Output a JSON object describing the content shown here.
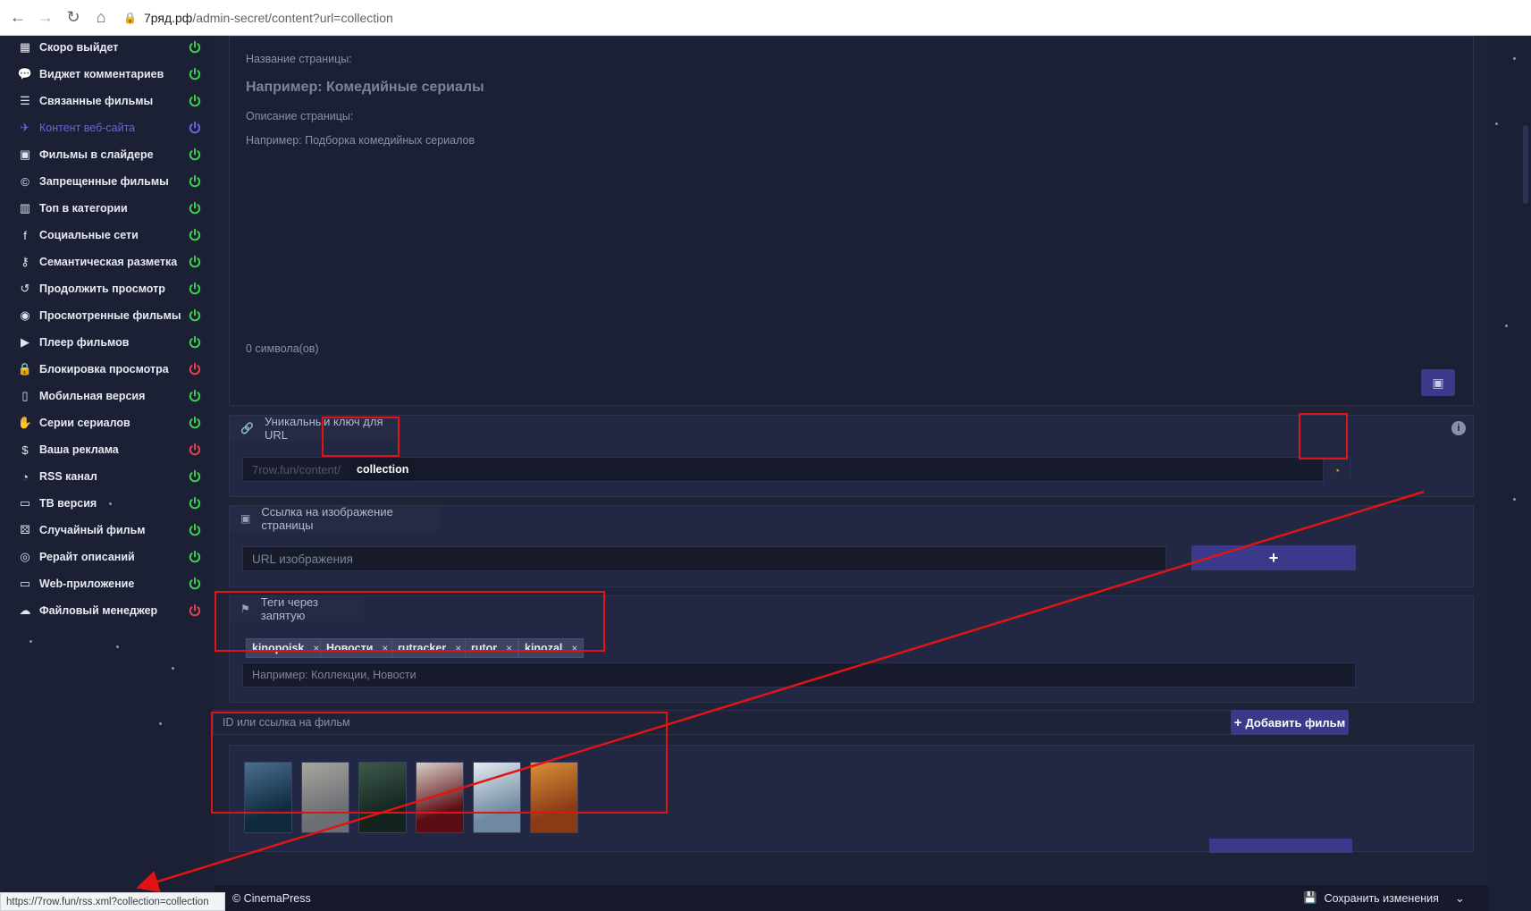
{
  "browser": {
    "url_host": "7ряд.рф",
    "url_path": "/admin-secret/content?url=collection"
  },
  "sidebar": {
    "items": [
      {
        "label": "Скоро выйдет",
        "icon": "calendar-icon",
        "glyph": "▦",
        "power": "green"
      },
      {
        "label": "Виджет комментариев",
        "icon": "comments-icon",
        "glyph": "💬",
        "power": "green"
      },
      {
        "label": "Связанные фильмы",
        "icon": "list-icon",
        "glyph": "☰",
        "power": "green"
      },
      {
        "label": "Контент веб-сайта",
        "icon": "rocket-icon",
        "glyph": "✈",
        "power": "violet",
        "active": true
      },
      {
        "label": "Фильмы в слайдере",
        "icon": "images-icon",
        "glyph": "▣",
        "power": "green"
      },
      {
        "label": "Запрещенные фильмы",
        "icon": "copyright-icon",
        "glyph": "©",
        "power": "green"
      },
      {
        "label": "Топ в категории",
        "icon": "chart-icon",
        "glyph": "▥",
        "power": "green"
      },
      {
        "label": "Социальные сети",
        "icon": "facebook-icon",
        "glyph": "f",
        "power": "green"
      },
      {
        "label": "Семантическая разметка",
        "icon": "key-icon",
        "glyph": "⚷",
        "power": "green"
      },
      {
        "label": "Продолжить просмотр",
        "icon": "history-icon",
        "glyph": "↺",
        "power": "green"
      },
      {
        "label": "Просмотренные фильмы",
        "icon": "eye-icon",
        "glyph": "◉",
        "power": "green"
      },
      {
        "label": "Плеер фильмов",
        "icon": "play-icon",
        "glyph": "▶",
        "power": "green"
      },
      {
        "label": "Блокировка просмотра",
        "icon": "lock-icon",
        "glyph": "🔒",
        "power": "red"
      },
      {
        "label": "Мобильная версия",
        "icon": "mobile-icon",
        "glyph": "▯",
        "power": "green"
      },
      {
        "label": "Серии сериалов",
        "icon": "hand-icon",
        "glyph": "✋",
        "power": "green"
      },
      {
        "label": "Ваша реклама",
        "icon": "dollar-icon",
        "glyph": "$",
        "power": "red"
      },
      {
        "label": "RSS канал",
        "icon": "rss-icon",
        "glyph": "◔",
        "power": "green"
      },
      {
        "label": "ТВ версия",
        "icon": "tv-icon",
        "glyph": "▭",
        "power": "green"
      },
      {
        "label": "Случайный фильм",
        "icon": "dice-icon",
        "glyph": "⚄",
        "power": "green"
      },
      {
        "label": "Рерайт описаний",
        "icon": "cookie-icon",
        "glyph": "◎",
        "power": "green"
      },
      {
        "label": "Web-приложение",
        "icon": "desktop-icon",
        "glyph": "▭",
        "power": "green"
      },
      {
        "label": "Файловый менеджер",
        "icon": "cloud-upload-icon",
        "glyph": "☁",
        "power": "red"
      }
    ]
  },
  "description": {
    "title_label": "Название страницы:",
    "title_placeholder": "Например: Комедийные сериалы",
    "desc_label": "Описание страницы:",
    "desc_placeholder": "Например: Подборка комедийных сериалов",
    "char_count": "0 символа(ов)"
  },
  "url_key": {
    "header": "Уникальный ключ для URL",
    "prefix": "7row.fun/content/",
    "value": "collection"
  },
  "image_link": {
    "header": "Ссылка на изображение страницы",
    "placeholder": "URL изображения",
    "add_label": "+"
  },
  "tags": {
    "header": "Теги через запятую",
    "items": [
      "kinopoisk",
      "Новости",
      "rutracker",
      "rutor",
      "kinozal"
    ],
    "remove_glyph": "×",
    "placeholder": "Например: Коллекции, Новости"
  },
  "films": {
    "input_placeholder": "ID или ссылка на фильм",
    "add_button": "Добавить фильм",
    "posters": [
      {
        "name": "poster-1",
        "colors": [
          "#0f2a3f",
          "#4b6f8f"
        ]
      },
      {
        "name": "poster-2",
        "colors": [
          "#6b6e75",
          "#a8a59c"
        ]
      },
      {
        "name": "poster-3",
        "colors": [
          "#13241f",
          "#3e5a4c"
        ]
      },
      {
        "name": "poster-4",
        "colors": [
          "#5a0d12",
          "#d9cfc7"
        ]
      },
      {
        "name": "poster-5",
        "colors": [
          "#6f8aa0",
          "#e4eaef"
        ]
      },
      {
        "name": "poster-6",
        "colors": [
          "#8a3a14",
          "#d9903a"
        ]
      }
    ]
  },
  "footer": {
    "copyright": "© CinemaPress",
    "save_label": "Сохранить изменения"
  },
  "status_bar": {
    "url": "https://7row.fun/rss.xml?collection=collection"
  },
  "colors": {
    "accent": "#3b3a8a",
    "power_green": "#3ecf4f",
    "power_red": "#e0424f",
    "power_violet": "#6c63d9",
    "highlight_red": "#e01414"
  }
}
